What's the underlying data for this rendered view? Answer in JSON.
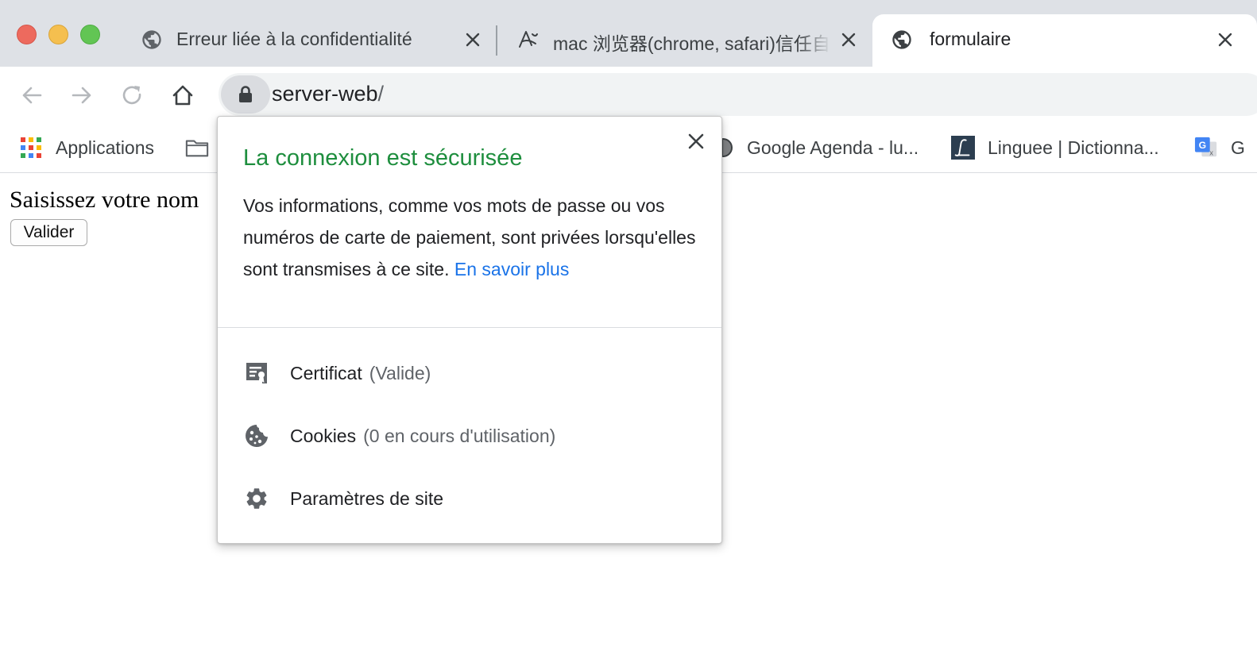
{
  "window": {
    "tabs": [
      {
        "title": "Erreur liée à la confidentialité",
        "icon": "globe-icon"
      },
      {
        "title": "mac 浏览器(chrome, safari)信任自",
        "icon": "site-logo-icon"
      },
      {
        "title": "formulaire",
        "icon": "globe-icon",
        "active": true
      }
    ]
  },
  "toolbar": {
    "url_host": "server-web",
    "url_path": "/"
  },
  "bookmarks": [
    {
      "label": "Applications",
      "icon": "apps-grid-icon"
    },
    {
      "label": "",
      "icon": "folder-icon"
    },
    {
      "label": "Google Agenda - lu...",
      "icon": "calendar-icon"
    },
    {
      "label": "Linguee | Dictionna...",
      "icon": "linguee-icon"
    },
    {
      "label": "G",
      "icon": "google-translate-icon"
    }
  ],
  "page": {
    "prompt": "Saisissez votre nom",
    "submit_label": "Valider"
  },
  "popup": {
    "title": "La connexion est sécurisée",
    "description": "Vos informations, comme vos mots de passe ou vos numéros de carte de paiement, sont privées lorsqu'elles sont transmises à ce site.",
    "learn_more": "En savoir plus",
    "rows": [
      {
        "label": "Certificat",
        "sub": "(Valide)",
        "icon": "certificate-icon"
      },
      {
        "label": "Cookies",
        "sub": "(0 en cours d'utilisation)",
        "icon": "cookie-icon"
      },
      {
        "label": "Paramètres de site",
        "sub": "",
        "icon": "gear-icon"
      }
    ]
  },
  "colors": {
    "secure_green": "#1e8e3e",
    "link_blue": "#1a73e8",
    "tabstrip_bg": "#dee1e6"
  }
}
